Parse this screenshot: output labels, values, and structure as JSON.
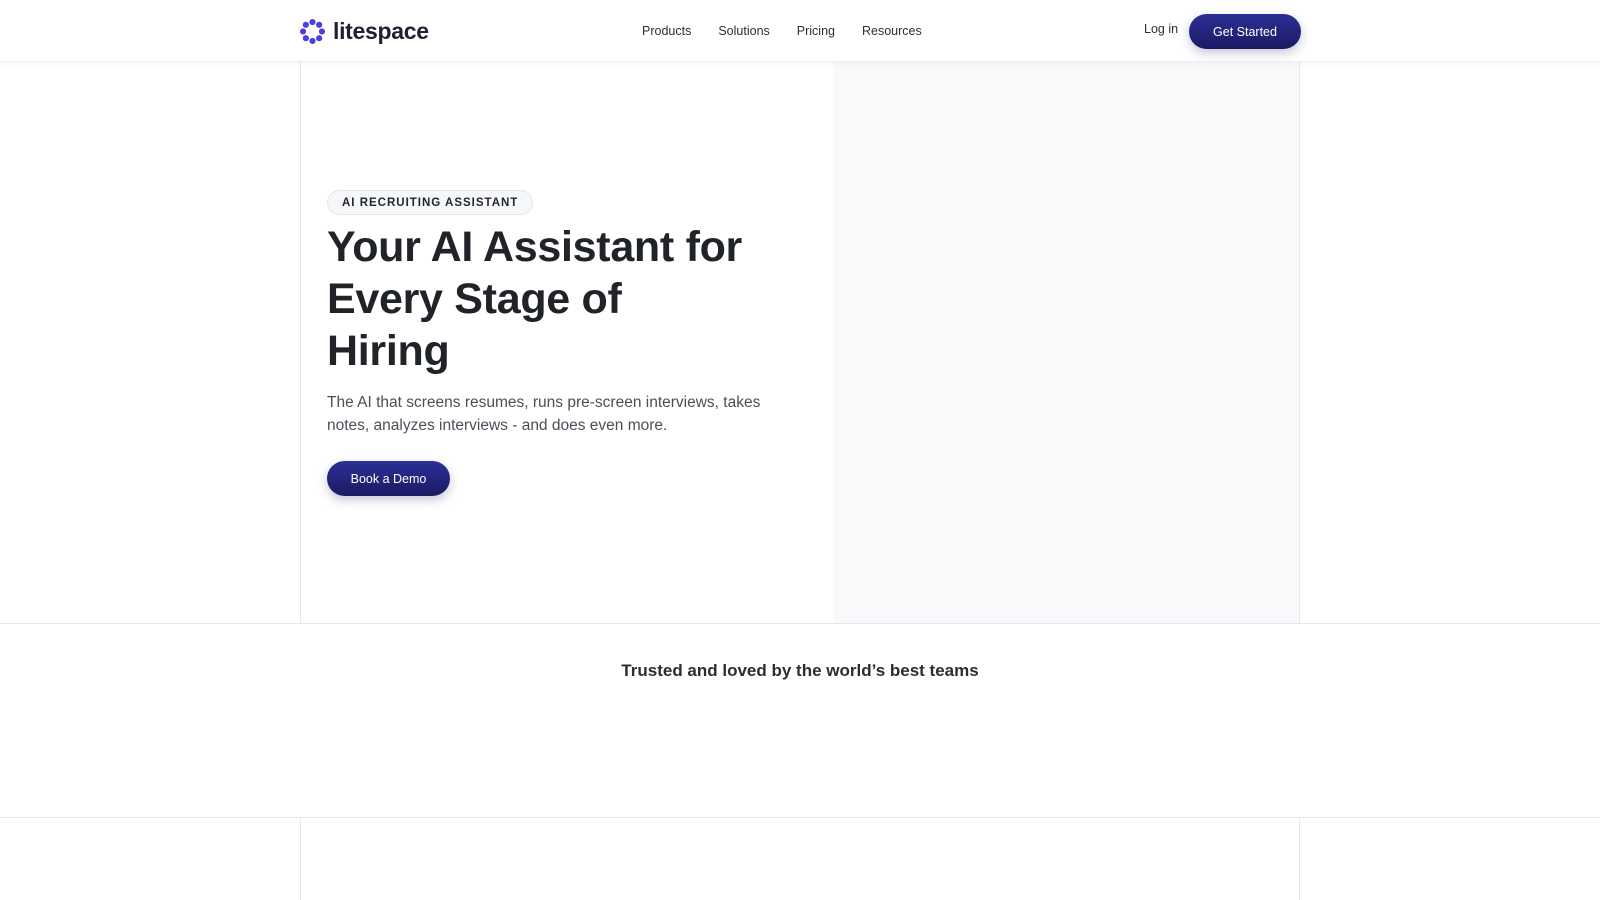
{
  "brand": {
    "name": "litespace",
    "accent_color": "#4b3fe0",
    "logo_icon": "flower-dots-icon"
  },
  "nav": {
    "items": [
      {
        "label": "Products"
      },
      {
        "label": "Solutions"
      },
      {
        "label": "Pricing"
      },
      {
        "label": "Resources"
      }
    ]
  },
  "header_actions": {
    "login_label": "Log in",
    "cta_label": "Get Started",
    "cta_color": "#1f1d6e"
  },
  "hero": {
    "badge": "AI RECRUITING ASSISTANT",
    "title": "Your AI Assistant for Every Stage of Hiring",
    "subtitle": "The AI that screens resumes, runs pre-screen interviews, takes notes, analyzes interviews - and does even more.",
    "cta_label": "Book a Demo"
  },
  "trusted": {
    "heading": "Trusted and loved by the world’s best teams"
  }
}
